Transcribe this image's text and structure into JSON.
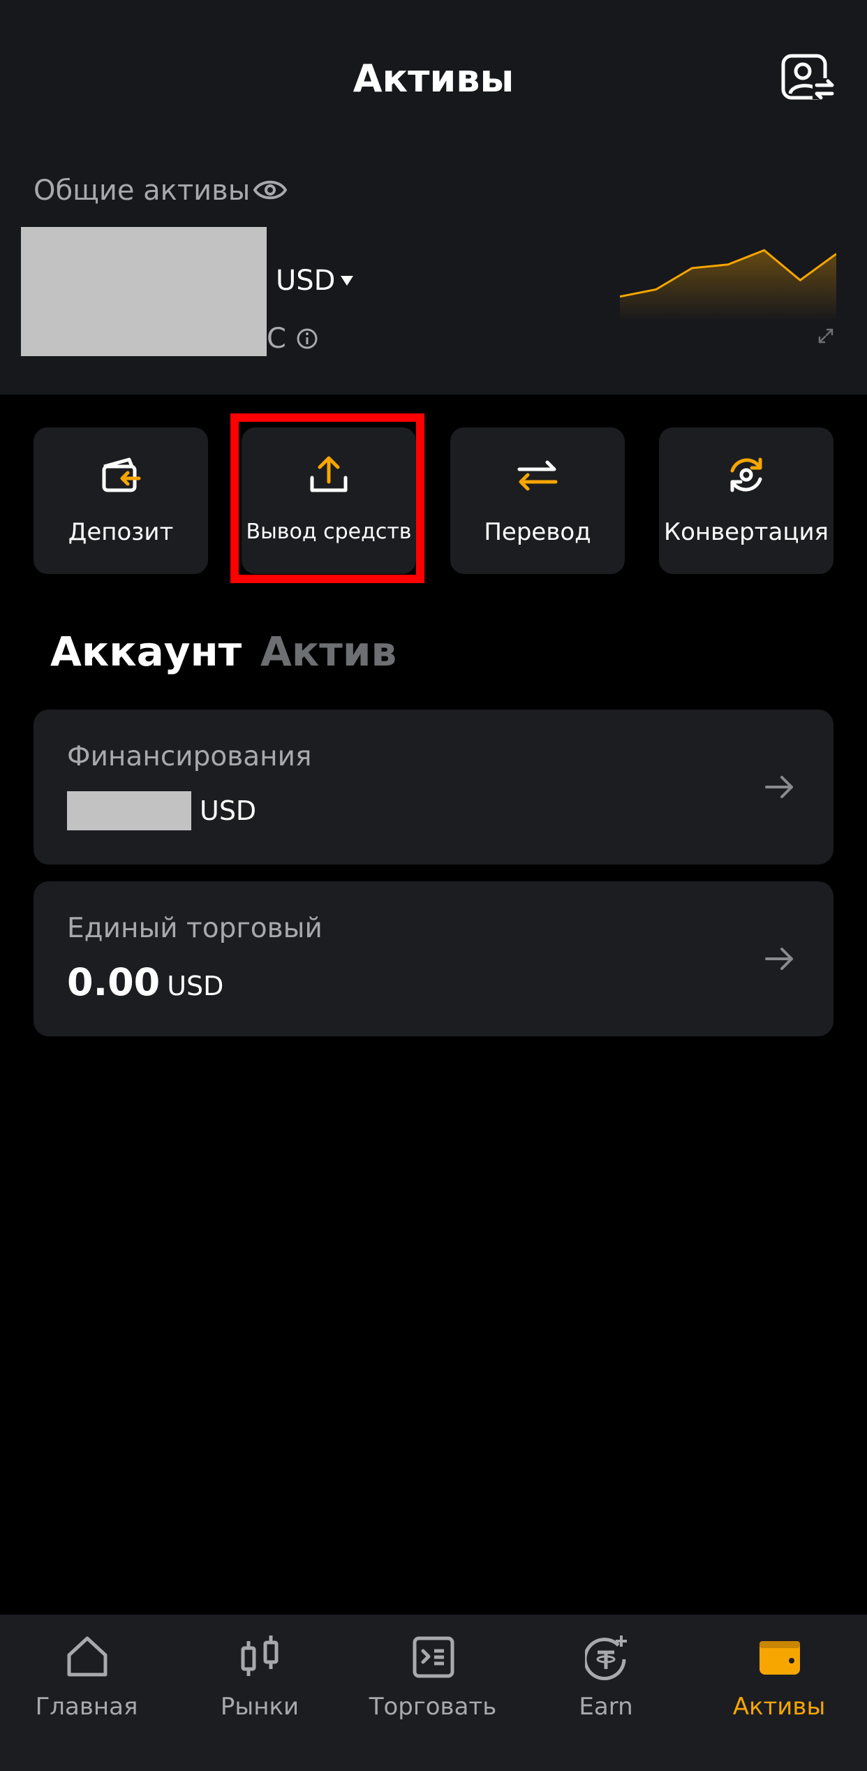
{
  "header": {
    "title": "Активы",
    "profile_icon": "profile-switch-icon"
  },
  "summary": {
    "label": "Общие активы",
    "visibility_icon": "eye-icon",
    "currency": "USD",
    "pnl_suffix": "C",
    "info_icon": "info-icon",
    "expand_icon": "expand-icon",
    "trend_values": [
      0.15,
      0.25,
      0.55,
      0.6,
      0.8,
      0.38,
      0.75
    ]
  },
  "actions": [
    {
      "label": "Депозит",
      "icon": "deposit-icon"
    },
    {
      "label": "Вывод средств",
      "icon": "withdraw-icon"
    },
    {
      "label": "Перевод",
      "icon": "transfer-icon"
    },
    {
      "label": "Конвертация",
      "icon": "convert-icon"
    }
  ],
  "tabs": {
    "account": "Аккаунт",
    "asset": "Актив"
  },
  "accounts": [
    {
      "name": "Финансирования",
      "amount": "",
      "currency": "USD"
    },
    {
      "name": "Единый торговый",
      "amount": "0.00",
      "currency": "USD"
    }
  ],
  "nav": [
    {
      "label": "Главная",
      "icon": "home-icon",
      "active": false
    },
    {
      "label": "Рынки",
      "icon": "candlestick-icon",
      "active": false
    },
    {
      "label": "Торговать",
      "icon": "trade-icon",
      "active": false
    },
    {
      "label": "Earn",
      "icon": "earn-icon",
      "active": false
    },
    {
      "label": "Активы",
      "icon": "wallet-icon",
      "active": true
    }
  ],
  "colors": {
    "accent": "#f7a600",
    "background": "#000000",
    "panel": "#17181c",
    "card": "#1c1d21",
    "muted_text": "#a8a9ad",
    "highlight": "#ff0000"
  }
}
